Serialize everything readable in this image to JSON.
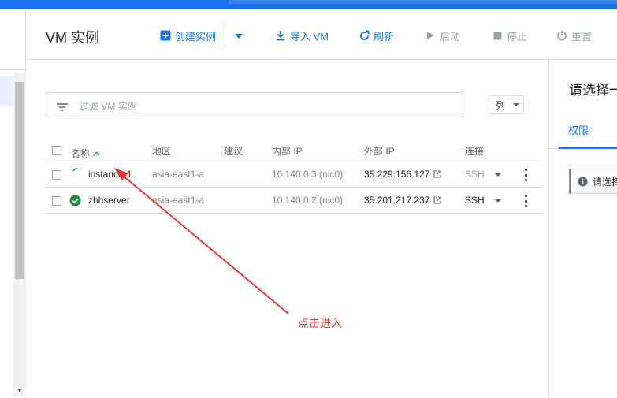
{
  "header": {
    "title": "VM 实例",
    "toolbar": {
      "create_label": "创建实例",
      "import_label": "导入 VM",
      "refresh_label": "刷新",
      "start_label": "启动",
      "stop_label": "停止",
      "reset_label": "重置"
    }
  },
  "filter": {
    "placeholder": "过滤 VM 实例"
  },
  "columns_button": {
    "label": "列"
  },
  "table": {
    "headers": {
      "name": "名称",
      "zone": "地区",
      "recommendation": "建议",
      "internal_ip": "内部 IP",
      "external_ip": "外部 IP",
      "connect": "连接"
    },
    "rows": [
      {
        "name": "instance-1",
        "zone": "asia-east1-a",
        "recommendation": "",
        "internal_ip": "10.140.0.3 (nic0)",
        "external_ip": "35.229.156.127",
        "connect": "SSH",
        "status": "starting"
      },
      {
        "name": "zhhserver",
        "zone": "asia-east1-a",
        "recommendation": "",
        "internal_ip": "10.140.0.2 (nic0)",
        "external_ip": "35.201.217.237",
        "connect": "SSH",
        "status": "running"
      }
    ]
  },
  "right_panel": {
    "title": "请选择一",
    "tab_label": "权限",
    "info_text": "请选择"
  },
  "annotation": {
    "text": "点击进入",
    "color": "#e53935"
  },
  "colors": {
    "accent": "#1a73e8",
    "running": "#1e8e3e",
    "disabled": "#9aa0a6"
  },
  "icons": {
    "create": "add-box-icon",
    "dropdown": "caret-down-icon",
    "import": "download-icon",
    "refresh": "refresh-icon",
    "start": "play-icon",
    "stop": "stop-icon",
    "reset": "power-icon",
    "filter": "filter-list-icon",
    "sort": "sort-up-icon",
    "external": "open-in-new-icon",
    "more": "more-vert-icon",
    "info": "info-icon"
  }
}
